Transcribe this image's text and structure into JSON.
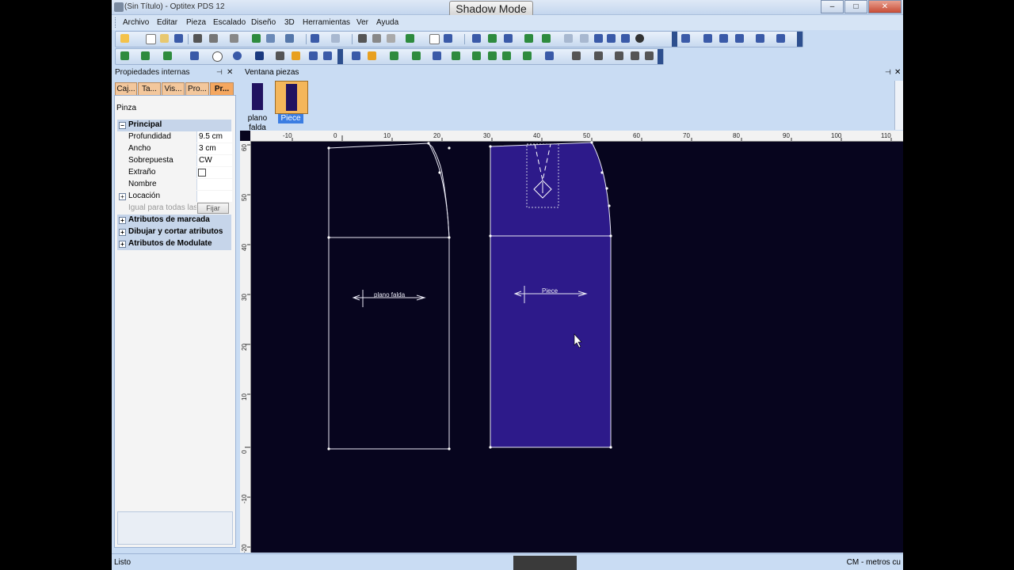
{
  "window": {
    "title": "(Sin Título) - Optitex PDS 12",
    "mode_badge": "Shadow Mode",
    "minimize": "–",
    "maximize": "□",
    "close": "✕"
  },
  "menu": [
    "Archivo",
    "Editar",
    "Pieza",
    "Escalado",
    "Diseño",
    "3D",
    "Herramientas",
    "Ver",
    "Ayuda"
  ],
  "properties_panel": {
    "title": "Propiedades internas",
    "pin": "⊣",
    "close": "✕",
    "tabs": [
      "Caj...",
      "Ta...",
      "Vis...",
      "Pro...",
      "Pr..."
    ],
    "object_label": "Pinza",
    "groups": {
      "principal": "Principal",
      "marcada": "Atributos de marcada",
      "dibujar": "Dibujar y cortar atributos",
      "modulate": "Atributos de Modulate"
    },
    "rows": {
      "profundidad": {
        "label": "Profundidad",
        "value": "9.5 cm"
      },
      "ancho": {
        "label": "Ancho",
        "value": "3 cm"
      },
      "sobrepuesta": {
        "label": "Sobrepuesta",
        "value": "CW"
      },
      "extrano": {
        "label": "Extraño"
      },
      "nombre": {
        "label": "Nombre",
        "value": ""
      },
      "locacion": {
        "label": "Locación"
      },
      "igual": {
        "label": "Igual para todas las ta",
        "button": "Fijar"
      }
    }
  },
  "pieces_window": {
    "title": "Ventana piezas",
    "pin": "⊣",
    "close": "✕",
    "pieces": [
      {
        "name": "plano falda",
        "selected": false
      },
      {
        "name": "Piece",
        "selected": true
      }
    ]
  },
  "canvas": {
    "background": "#07051e",
    "piece_fill": "#2d1a8a",
    "ruler_top_labels": [
      "-10",
      "0",
      "10",
      "20",
      "30",
      "40",
      "50",
      "60",
      "70",
      "80",
      "90",
      "100",
      "110"
    ],
    "ruler_left_labels": [
      "60",
      "50",
      "40",
      "30",
      "20",
      "10",
      "0",
      "-10",
      "-20"
    ],
    "piece_labels": {
      "left": "plano falda",
      "right": "Piece"
    }
  },
  "status": {
    "left": "Listo",
    "right": "CM - metros cu"
  },
  "colors": {
    "accent": "#3b7de2",
    "tab_orange": "#f5a75f",
    "panel": "#c9dcf3"
  }
}
